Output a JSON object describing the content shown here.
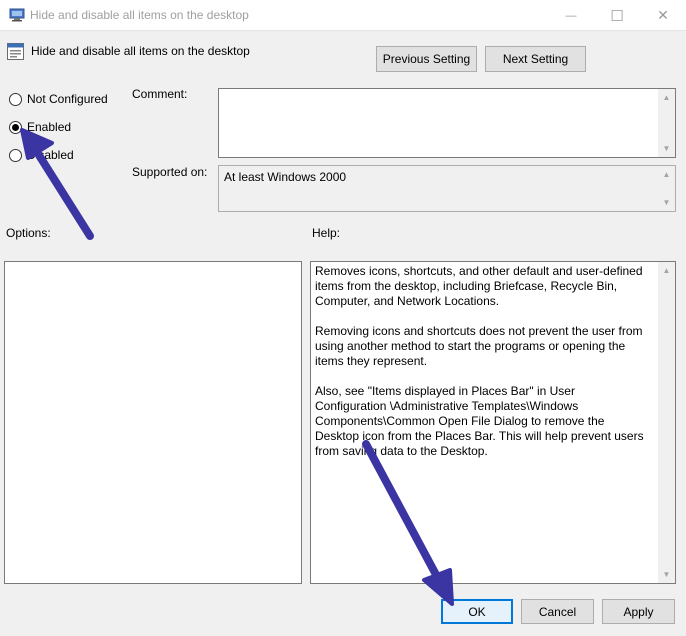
{
  "window": {
    "title": "Hide and disable all items on the desktop",
    "minimize_glyph": "—",
    "maximize_glyph": "☐",
    "close_glyph": "✕"
  },
  "header": {
    "policy_title": "Hide and disable all items on the desktop",
    "previous_setting_label": "Previous Setting",
    "next_setting_label": "Next Setting"
  },
  "state": {
    "options": [
      {
        "label": "Not Configured",
        "checked": false
      },
      {
        "label": "Enabled",
        "checked": true
      },
      {
        "label": "Disabled",
        "checked": false
      }
    ]
  },
  "comment": {
    "label": "Comment:",
    "value": ""
  },
  "supported": {
    "label": "Supported on:",
    "value": "At least Windows 2000"
  },
  "options_section": {
    "label": "Options:"
  },
  "help_section": {
    "label": "Help:",
    "paragraphs": [
      "Removes icons, shortcuts, and other default and user-defined items from the desktop, including Briefcase, Recycle Bin, Computer, and Network Locations.",
      "Removing icons and shortcuts does not prevent the user from using another method to start the programs or opening the items they represent.",
      "Also, see \"Items displayed in Places Bar\" in User Configuration \\Administrative Templates\\Windows Components\\Common Open File Dialog to remove the Desktop icon from the Places Bar. This will help prevent users from saving data to the Desktop."
    ]
  },
  "footer": {
    "ok_label": "OK",
    "cancel_label": "Cancel",
    "apply_label": "Apply"
  },
  "colors": {
    "annotation_arrow": "#3a35a3",
    "focus_blue": "#0078d7"
  },
  "icons": {
    "app": "group-policy-editor-icon",
    "policy": "policy-setting-icon"
  }
}
